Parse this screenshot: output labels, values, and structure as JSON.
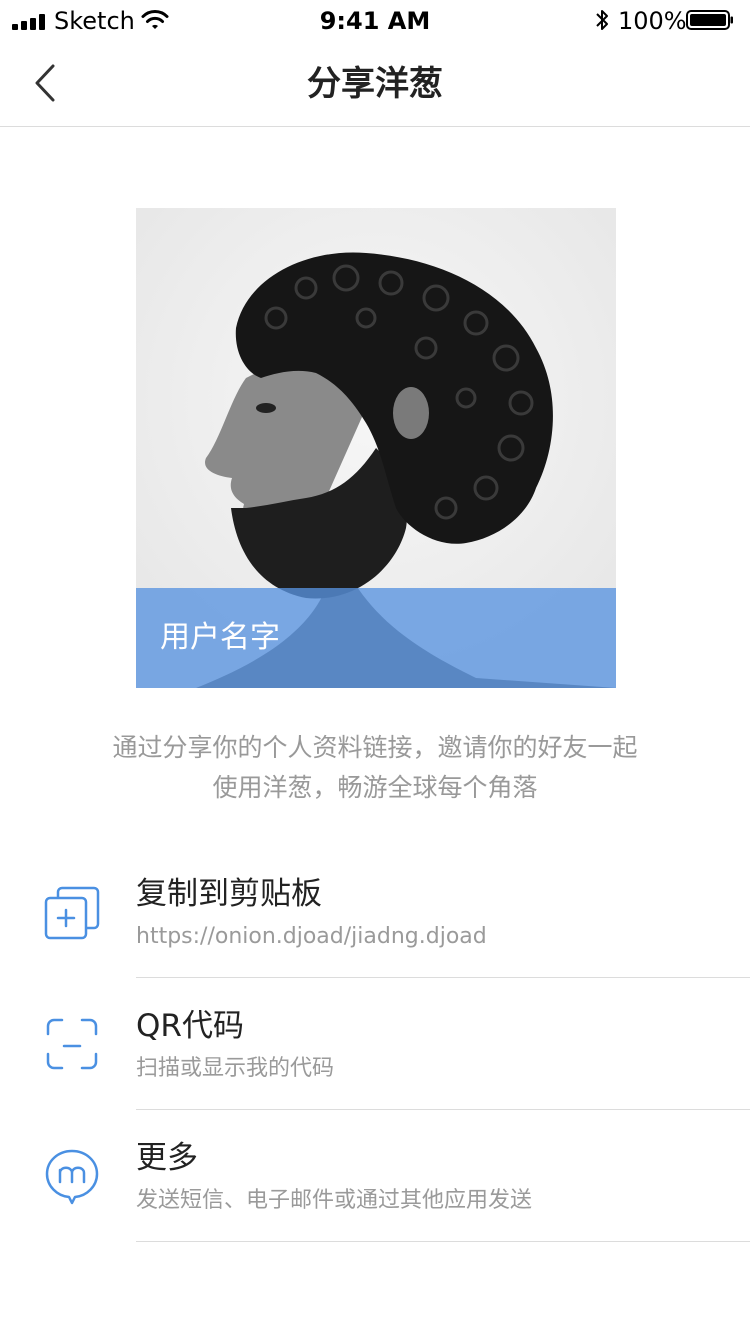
{
  "status_bar": {
    "carrier": "Sketch",
    "time": "9:41 AM",
    "battery": "100%"
  },
  "nav": {
    "title": "分享洋葱"
  },
  "profile": {
    "user_name": "用户名字"
  },
  "description": {
    "line1": "通过分享你的个人资料链接，邀请你的好友一起",
    "line2": "使用洋葱，畅游全球每个角落"
  },
  "options": [
    {
      "title": "复制到剪贴板",
      "subtitle": "https://onion.djoad/jiadng.djoad",
      "icon": "copy-icon"
    },
    {
      "title": "QR代码",
      "subtitle": "扫描或显示我的代码",
      "icon": "qr-scan-icon"
    },
    {
      "title": "更多",
      "subtitle": "发送短信、电子邮件或通过其他应用发送",
      "icon": "message-m-icon"
    }
  ],
  "colors": {
    "accent": "#4A90E2",
    "overlay": "#5894E0"
  }
}
